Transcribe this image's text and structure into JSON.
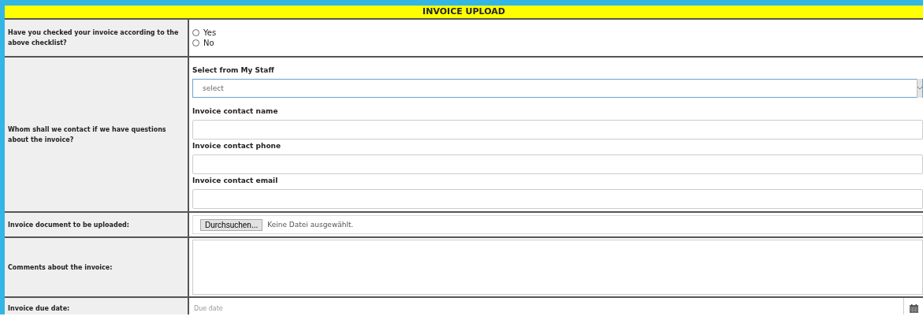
{
  "title": "INVOICE UPLOAD",
  "rows": [
    {
      "kind": "radio",
      "label": "Have you checked your invoice according to the above checklist?",
      "options": [
        {
          "label": "Yes",
          "selected": false
        },
        {
          "label": "No",
          "selected": false
        }
      ]
    },
    {
      "kind": "contact",
      "label": "Whom shall we contact if we have questions about the invoice?",
      "fields": [
        {
          "kind": "select",
          "label": "Select from My Staff",
          "value": "select"
        },
        {
          "kind": "text",
          "label": "Invoice contact name"
        },
        {
          "kind": "text",
          "label": "Invoice contact phone"
        },
        {
          "kind": "text",
          "label": "Invoice contact email"
        }
      ]
    },
    {
      "kind": "file",
      "label": "Invoice document to be uploaded:",
      "button": "Durchsuchen...",
      "status": "Keine Datei ausgewählt."
    },
    {
      "kind": "textarea",
      "label": "Comments about the invoice:"
    },
    {
      "kind": "date",
      "label": "Invoice due date:",
      "placeholder": "Due date"
    }
  ]
}
